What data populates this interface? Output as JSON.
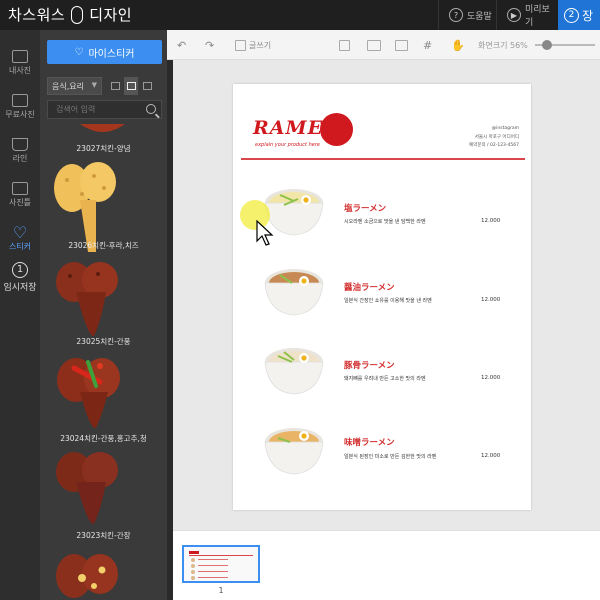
{
  "app": {
    "brand_left": "차스워스",
    "brand_right": "디자인"
  },
  "topbar": {
    "help": "도움말",
    "preview": "미리보기",
    "step2_num": "2",
    "step2_label": "장"
  },
  "rail": {
    "my_photos": "내사진",
    "free_photos": "무료사진",
    "lines": "라인",
    "frames": "사진틀",
    "stickers": "스티커",
    "temp_save_num": "1",
    "temp_save": "임시저장"
  },
  "panel": {
    "my_sticker_button": "마이스티커",
    "category": "음식,요리",
    "search_placeholder": "검색어 입력",
    "items": [
      {
        "label": "23027치킨-양념"
      },
      {
        "label": "23026치킨-후라,치즈"
      },
      {
        "label": "23025치킨-간풍"
      },
      {
        "label": "23024치킨-간풍,홍고추,청"
      },
      {
        "label": "23023치킨-간장"
      }
    ]
  },
  "toolbar": {
    "text_tool": "글쓰기",
    "zoom_label": "화면크기 56%"
  },
  "menu": {
    "logo": "RAMEN",
    "tagline": "explain your product here",
    "info_lines": [
      "@instagram",
      "서울시 마포구 어디어디",
      "예약문의 / 02-123-4567"
    ],
    "items": [
      {
        "title": "塩ラーメン",
        "desc": "시오라멘 소금으로 맛을 낸 담백한 라멘",
        "price": "12.000"
      },
      {
        "title": "醤油ラーメン",
        "desc": "일본식 간장인 쇼유를 이용해 맛을 낸 라멘",
        "price": "12.000"
      },
      {
        "title": "豚骨ラーメン",
        "desc": "돼지뼈를 우려내 만든 고소한 맛의 라멘",
        "price": "12.000"
      },
      {
        "title": "味噌ラーメン",
        "desc": "일본식 된장인 미소로 만든 깊한한 맛의 라멘",
        "price": "12.000"
      }
    ]
  },
  "pages": {
    "current_page_number": "1"
  },
  "colors": {
    "accent": "#3c8ff0",
    "step_blue": "#1f74d6",
    "ramen_red": "#d0191f"
  }
}
